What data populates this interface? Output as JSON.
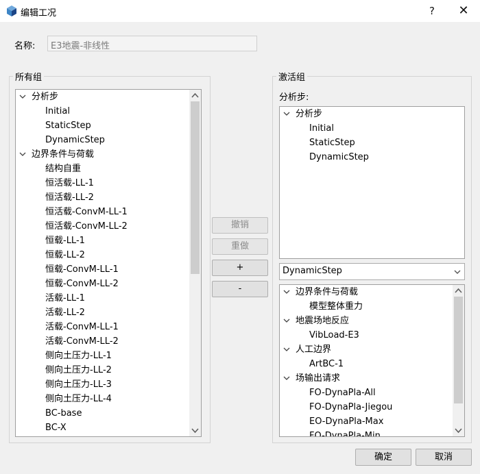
{
  "window": {
    "title": "编辑工况",
    "help_glyph": "?",
    "close_glyph": "✕",
    "icon": "cube-icon"
  },
  "name": {
    "label": "名称:",
    "value": "E3地震-非线性"
  },
  "all_groups": {
    "title": "所有组",
    "tree": [
      {
        "label": "分析步",
        "level": 0,
        "expanded": true
      },
      {
        "label": "Initial",
        "level": 1
      },
      {
        "label": "StaticStep",
        "level": 1
      },
      {
        "label": "DynamicStep",
        "level": 1
      },
      {
        "label": "边界条件与荷载",
        "level": 0,
        "expanded": true
      },
      {
        "label": "结构自重",
        "level": 1
      },
      {
        "label": "恒活载-LL-1",
        "level": 1
      },
      {
        "label": "恒活载-LL-2",
        "level": 1
      },
      {
        "label": "恒活载-ConvM-LL-1",
        "level": 1
      },
      {
        "label": "恒活载-ConvM-LL-2",
        "level": 1
      },
      {
        "label": "恒载-LL-1",
        "level": 1
      },
      {
        "label": "恒载-LL-2",
        "level": 1
      },
      {
        "label": "恒载-ConvM-LL-1",
        "level": 1
      },
      {
        "label": "恒载-ConvM-LL-2",
        "level": 1
      },
      {
        "label": "活载-LL-1",
        "level": 1
      },
      {
        "label": "活载-LL-2",
        "level": 1
      },
      {
        "label": "活载-ConvM-LL-1",
        "level": 1
      },
      {
        "label": "活载-ConvM-LL-2",
        "level": 1
      },
      {
        "label": "侧向土压力-LL-1",
        "level": 1
      },
      {
        "label": "侧向土压力-LL-2",
        "level": 1
      },
      {
        "label": "侧向土压力-LL-3",
        "level": 1
      },
      {
        "label": "侧向土压力-LL-4",
        "level": 1
      },
      {
        "label": "BC-base",
        "level": 1
      },
      {
        "label": "BC-X",
        "level": 1
      }
    ]
  },
  "middle_buttons": {
    "undo": "撤销",
    "redo": "重做",
    "add": "+",
    "remove": "-"
  },
  "active_groups": {
    "title": "激活组",
    "steps_label": "分析步:",
    "steps_tree": [
      {
        "label": "分析步",
        "level": 0,
        "expanded": true
      },
      {
        "label": "Initial",
        "level": 1
      },
      {
        "label": "StaticStep",
        "level": 1
      },
      {
        "label": "DynamicStep",
        "level": 1
      }
    ],
    "step_select": "DynamicStep",
    "groups_tree": [
      {
        "label": "边界条件与荷载",
        "level": 0,
        "expanded": true
      },
      {
        "label": "模型整体重力",
        "level": 1
      },
      {
        "label": "地震场地反应",
        "level": 0,
        "expanded": true
      },
      {
        "label": "VibLoad-E3",
        "level": 1
      },
      {
        "label": "人工边界",
        "level": 0,
        "expanded": true
      },
      {
        "label": "ArtBC-1",
        "level": 1
      },
      {
        "label": "场输出请求",
        "level": 0,
        "expanded": true
      },
      {
        "label": "FO-DynaPla-All",
        "level": 1
      },
      {
        "label": "FO-DynaPla-Jiegou",
        "level": 1
      },
      {
        "label": "EO-DynaPla-Max",
        "level": 1
      },
      {
        "label": "FO-DynaPla-Min",
        "level": 1
      }
    ]
  },
  "footer": {
    "ok": "确定",
    "cancel": "取消"
  }
}
